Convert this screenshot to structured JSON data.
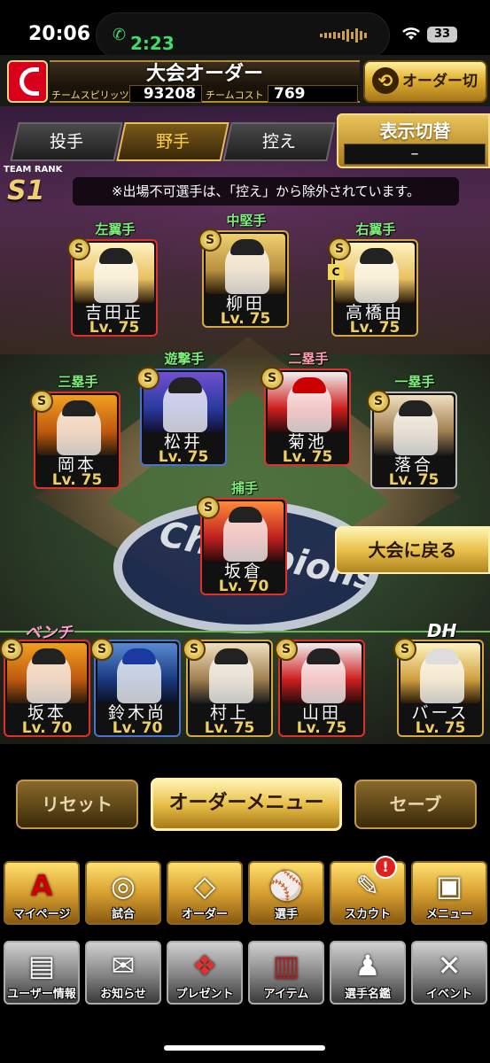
{
  "status_bar": {
    "time": "20:06",
    "call_timer": "2:23",
    "battery": "33",
    "wifi_icon": "wifi-icon",
    "call_icon": "phone-icon"
  },
  "header": {
    "title": "大会オーダー",
    "team_spirits_label": "チームスピリッツ",
    "team_spirits_value": "93208",
    "team_cost_label": "チームコスト",
    "team_cost_value": "769",
    "order_switch_label": "オーダー切替"
  },
  "tabs": [
    {
      "label": "投手",
      "active": false
    },
    {
      "label": "野手",
      "active": true
    },
    {
      "label": "控え",
      "active": false
    }
  ],
  "display_switch": {
    "label": "表示切替",
    "value": "–"
  },
  "team_rank": {
    "label": "TEAM RANK",
    "value": "S1"
  },
  "notice": "※出場不可選手は、「控え」から除外されています。",
  "lineup": [
    {
      "position": "左翼手",
      "name": "吉田正",
      "level": "Lv. 75",
      "rank_badge": "S"
    },
    {
      "position": "中堅手",
      "name": "柳田",
      "level": "Lv. 75",
      "rank_badge": "S"
    },
    {
      "position": "右翼手",
      "name": "高橋由",
      "level": "Lv. 75",
      "rank_badge": "S",
      "extra_badge": "C"
    },
    {
      "position": "三塁手",
      "name": "岡本",
      "level": "Lv. 75",
      "rank_badge": "S"
    },
    {
      "position": "遊撃手",
      "name": "松井",
      "level": "Lv. 75",
      "rank_badge": "S"
    },
    {
      "position": "二塁手",
      "name": "菊池",
      "level": "Lv. 75",
      "rank_badge": "S"
    },
    {
      "position": "一塁手",
      "name": "落合",
      "level": "Lv. 75",
      "rank_badge": "S"
    },
    {
      "position": "捕手",
      "name": "坂倉",
      "level": "Lv. 70",
      "rank_badge": "S"
    }
  ],
  "field_logo_text": "Champions",
  "back_button": "大会に戻る",
  "bench_label": "ベンチ",
  "dh_label": "DH",
  "bench": [
    {
      "name": "坂本",
      "level": "Lv. 70",
      "rank_badge": "S"
    },
    {
      "name": "鈴木尚",
      "level": "Lv. 70",
      "rank_badge": "S"
    },
    {
      "name": "村上",
      "level": "Lv. 75",
      "rank_badge": "S"
    },
    {
      "name": "山田",
      "level": "Lv. 75",
      "rank_badge": "S"
    }
  ],
  "dh": {
    "name": "バース",
    "level": "Lv. 75",
    "rank_badge": "S"
  },
  "actions": {
    "reset": "リセット",
    "order_menu": "オーダーメニュー",
    "save": "セーブ"
  },
  "nav_main": [
    {
      "label": "マイページ",
      "icon": "home-a-icon"
    },
    {
      "label": "試合",
      "icon": "stadium-icon"
    },
    {
      "label": "オーダー",
      "icon": "field-icon"
    },
    {
      "label": "選手",
      "icon": "player-icon"
    },
    {
      "label": "スカウト",
      "icon": "scout-icon"
    },
    {
      "label": "メニュー",
      "icon": "menu-character-icon"
    }
  ],
  "scout_alert": "!",
  "nav_sub": [
    {
      "label": "ユーザー情報",
      "icon": "user-card-icon"
    },
    {
      "label": "お知らせ",
      "icon": "news-icon"
    },
    {
      "label": "プレゼント",
      "icon": "gift-icon"
    },
    {
      "label": "アイテム",
      "icon": "item-book-icon"
    },
    {
      "label": "選手名鑑",
      "icon": "player-book-icon"
    },
    {
      "label": "イベント",
      "icon": "event-bat-icon"
    }
  ]
}
